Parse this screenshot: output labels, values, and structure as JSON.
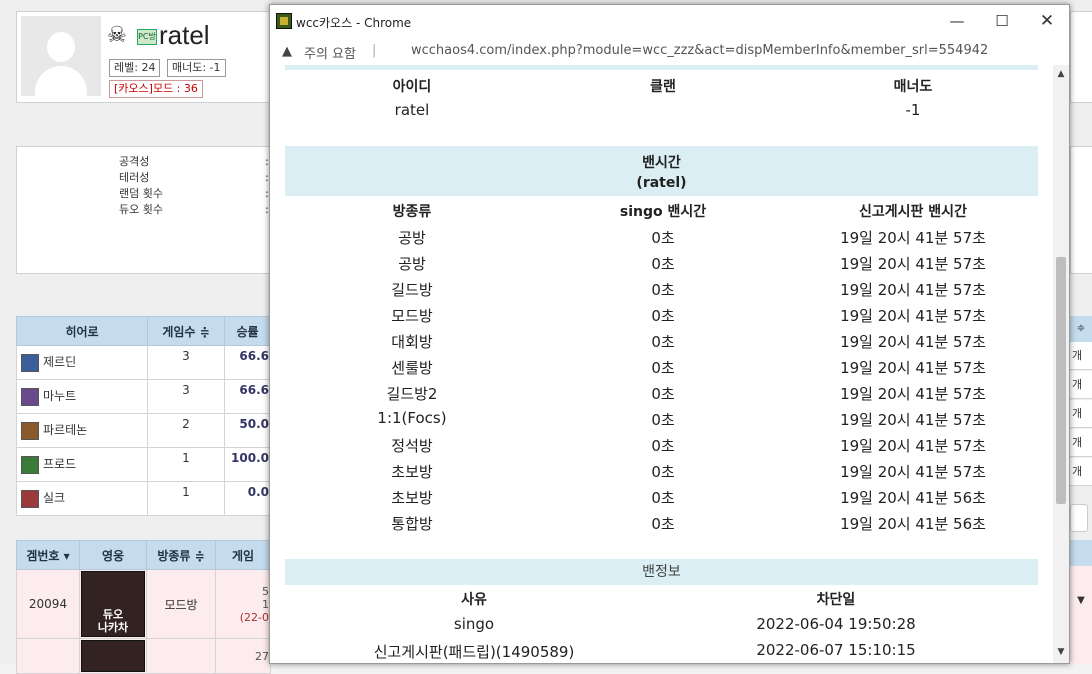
{
  "background": {
    "profile": {
      "name": "ratel",
      "badge": "PC방",
      "level": "레벨: 24",
      "manner": "매너도: -1",
      "mode": "[카오스]모드 : 36"
    },
    "stats": [
      "공격성",
      "테러성",
      "랜덤 횟수",
      "듀오 횟수"
    ],
    "hero_table": {
      "headers": [
        "히어로",
        "게임수 ≑",
        "승률"
      ],
      "rows": [
        {
          "hero": "제르딘",
          "games": "3",
          "rate": "66.6"
        },
        {
          "hero": "마누트",
          "games": "3",
          "rate": "66.6"
        },
        {
          "hero": "파르테논",
          "games": "2",
          "rate": "50.0"
        },
        {
          "hero": "프로드",
          "games": "1",
          "rate": "100.0"
        },
        {
          "hero": "실크",
          "games": "1",
          "rate": "0.0"
        }
      ]
    },
    "game_table": {
      "headers": [
        "겜번호 ▾",
        "영웅",
        "방종류 ≑",
        "게임"
      ],
      "row": {
        "id": "20094",
        "thumb_top": "듀오",
        "thumb_bottom": "나카차",
        "room": "모드방",
        "game_a": "5",
        "game_b": "1",
        "game_c": "(22-0",
        "next_a": "27"
      }
    },
    "right_strip": {
      "header": "≑",
      "cells": [
        "개",
        "개",
        "개",
        "개",
        "개"
      ],
      "arrow": "▼"
    }
  },
  "popup": {
    "window_title": "wcc카오스 - Chrome",
    "warning_label": "주의 요함",
    "url": "wcchaos4.com/index.php?module=wcc_zzz&act=dispMemberInfo&member_srl=554942",
    "id_section": {
      "headers": [
        "아이디",
        "클랜",
        "매너도"
      ],
      "values": [
        "ratel",
        "",
        "-1"
      ]
    },
    "ban_time": {
      "title": "밴시간",
      "subtitle": "(ratel)",
      "headers": [
        "방종류",
        "singo 밴시간",
        "신고게시판 밴시간"
      ],
      "rows": [
        [
          "공방",
          "0초",
          "19일 20시 41분 57초"
        ],
        [
          "공방",
          "0초",
          "19일 20시 41분 57초"
        ],
        [
          "길드방",
          "0초",
          "19일 20시 41분 57초"
        ],
        [
          "모드방",
          "0초",
          "19일 20시 41분 57초"
        ],
        [
          "대회방",
          "0초",
          "19일 20시 41분 57초"
        ],
        [
          "센룰방",
          "0초",
          "19일 20시 41분 57초"
        ],
        [
          "길드방2",
          "0초",
          "19일 20시 41분 57초"
        ],
        [
          "1:1(Focs)",
          "0초",
          "19일 20시 41분 57초"
        ],
        [
          "정석방",
          "0초",
          "19일 20시 41분 57초"
        ],
        [
          "초보방",
          "0초",
          "19일 20시 41분 57초"
        ],
        [
          "초보방",
          "0초",
          "19일 20시 41분 56초"
        ],
        [
          "통합방",
          "0초",
          "19일 20시 41분 56초"
        ]
      ]
    },
    "ban_info": {
      "title": "밴정보",
      "headers": [
        "사유",
        "차단일"
      ],
      "rows": [
        [
          "singo",
          "2022-06-04 19:50:28"
        ],
        [
          "신고게시판(패드립)(1490589)",
          "2022-06-07 15:10:15"
        ]
      ]
    }
  }
}
